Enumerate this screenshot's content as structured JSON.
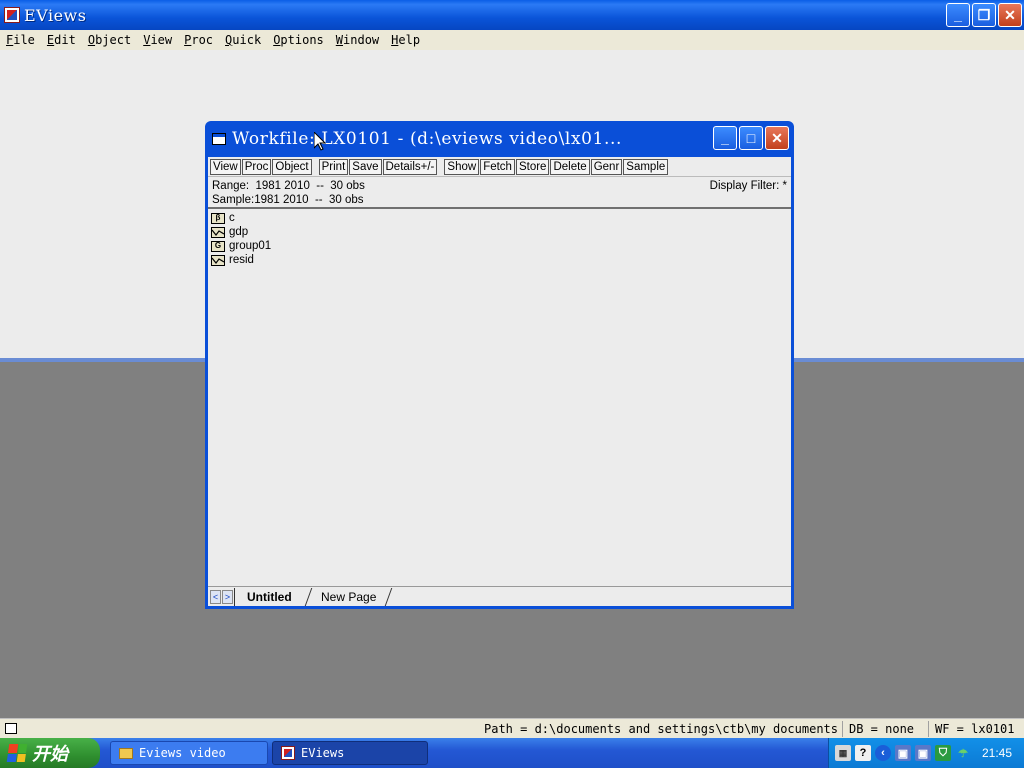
{
  "app": {
    "title": "EViews",
    "controls": {
      "minimize": "_",
      "restore": "❐",
      "close": "✕"
    }
  },
  "menu": [
    {
      "label": "File",
      "key": "F",
      "rest": "ile"
    },
    {
      "label": "Edit",
      "key": "E",
      "rest": "dit"
    },
    {
      "label": "Object",
      "key": "O",
      "rest": "bject"
    },
    {
      "label": "View",
      "key": "V",
      "rest": "iew"
    },
    {
      "label": "Proc",
      "key": "P",
      "rest": "roc"
    },
    {
      "label": "Quick",
      "key": "Q",
      "rest": "uick"
    },
    {
      "label": "Options",
      "key": "O",
      "rest": "ptions"
    },
    {
      "label": "Window",
      "key": "W",
      "rest": "indow"
    },
    {
      "label": "Help",
      "key": "H",
      "rest": "elp"
    }
  ],
  "workfile": {
    "title": "Workfile: LX0101 - (d:\\eviews video\\lx01...",
    "toolbar": [
      "View",
      "Proc",
      "Object",
      "Print",
      "Save",
      "Details+/-",
      "Show",
      "Fetch",
      "Store",
      "Delete",
      "Genr",
      "Sample"
    ],
    "range_label": "Range:",
    "range_value": "1981 2010  --  30 obs",
    "sample_label": "Sample:",
    "sample_value": "1981 2010  --  30 obs",
    "display_filter": "Display Filter: *",
    "objects": [
      {
        "name": "c",
        "type": "coefficient",
        "icon_glyph": "β"
      },
      {
        "name": "gdp",
        "type": "series",
        "icon_glyph": ""
      },
      {
        "name": "group01",
        "type": "group",
        "icon_glyph": "G"
      },
      {
        "name": "resid",
        "type": "series",
        "icon_glyph": ""
      }
    ],
    "tabs": {
      "left_arrow": "<",
      "right_arrow": ">",
      "active": "Untitled",
      "new_page": "New Page"
    }
  },
  "status": {
    "path": "Path = d:\\documents and settings\\ctb\\my documents",
    "db": "DB = none",
    "wf": "WF = lx0101"
  },
  "taskbar": {
    "start_label": "开始",
    "tasks": [
      "Eviews video",
      "EViews"
    ],
    "clock": "21:45",
    "tray_help": "?"
  },
  "colors": {
    "titlebar": "#0a54d8",
    "workspace": "#ececec",
    "desktop_gray": "#808080",
    "start_green": "#2f8f2f"
  }
}
